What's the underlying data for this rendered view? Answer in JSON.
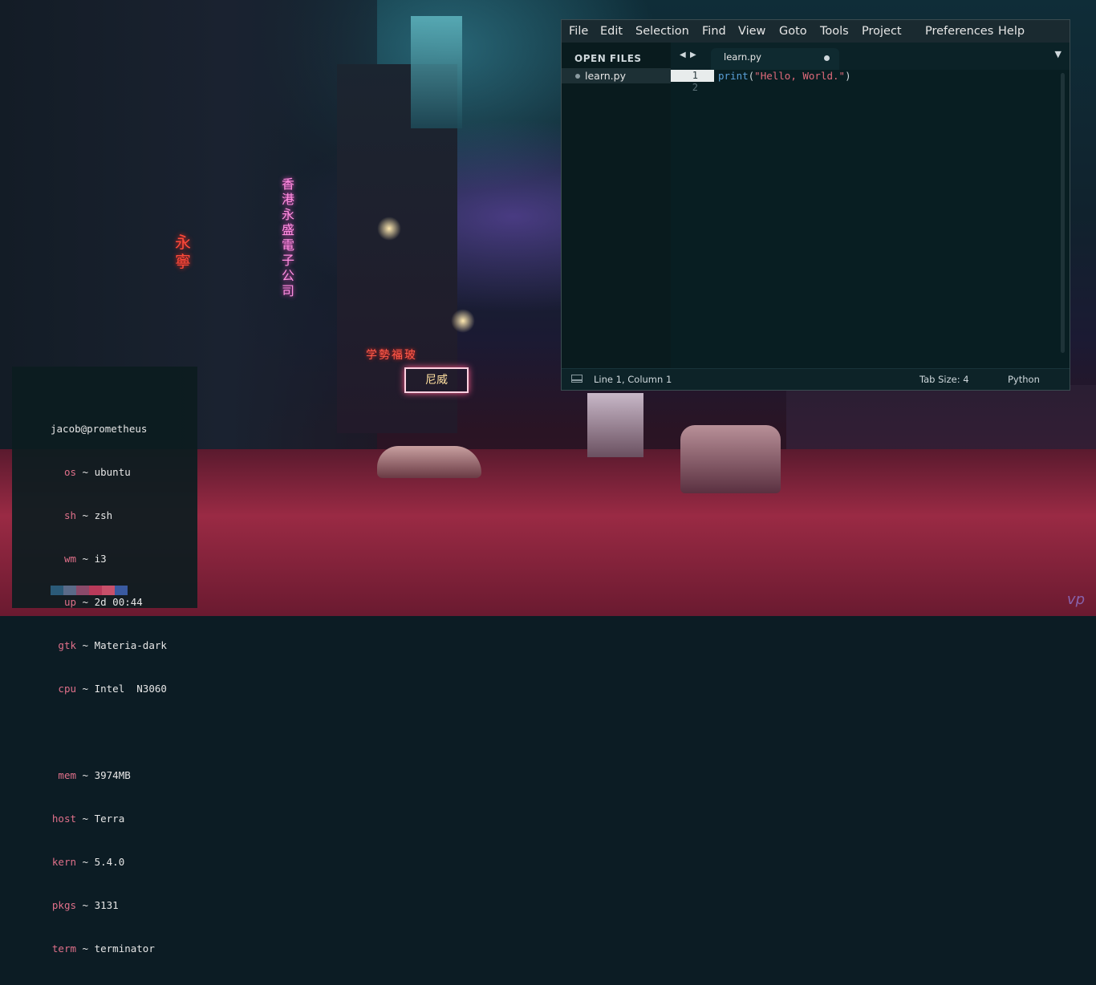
{
  "editor": {
    "menu": [
      "File",
      "Edit",
      "Selection",
      "Find",
      "View",
      "Goto",
      "Tools",
      "Project",
      "Preferences",
      "Help"
    ],
    "sidebar": {
      "heading": "OPEN FILES",
      "files": [
        "learn.py"
      ]
    },
    "tab": {
      "title": "learn.py",
      "modified": true
    },
    "gutter": [
      "1",
      "2"
    ],
    "code": {
      "function": "print",
      "open_paren": "(",
      "string": "\"Hello, World.\"",
      "close_paren": ")"
    },
    "status": {
      "position": "Line 1, Column 1",
      "tab_size": "Tab Size: 4",
      "syntax": "Python"
    },
    "colors": {
      "background": "#081e22",
      "menubar": "#1a2a30",
      "function": "#5aa0d8",
      "string": "#e06a7a"
    },
    "icons": {
      "nav_back": "◀",
      "nav_forward": "▶",
      "tab_dropdown": "▼"
    }
  },
  "terminal": {
    "header": "jacob@prometheus",
    "rows": [
      {
        "key": "os",
        "value": "ubuntu"
      },
      {
        "key": "sh",
        "value": "zsh"
      },
      {
        "key": "wm",
        "value": "i3"
      },
      {
        "key": "up",
        "value": "2d 00:44"
      },
      {
        "key": "gtk",
        "value": "Materia-dark"
      },
      {
        "key": "cpu",
        "value": "Intel  N3060"
      },
      {
        "key": "mem",
        "value": "3974MB"
      },
      {
        "key": "host",
        "value": "Terra"
      },
      {
        "key": "kern",
        "value": "5.4.0"
      },
      {
        "key": "pkgs",
        "value": "3131"
      },
      {
        "key": "term",
        "value": "terminator"
      }
    ],
    "separator": "~",
    "palette": [
      "#2b5a78",
      "#5a6a88",
      "#8a4a6a",
      "#b83a5a",
      "#c8506a",
      "#3a5aa0"
    ]
  },
  "wallpaper": {
    "neon_vertical": "香港永盛電子公司",
    "neon_red": "永寧",
    "neon_sign": "学勢福玻",
    "neon_box": "尼威",
    "signature": "vp"
  }
}
